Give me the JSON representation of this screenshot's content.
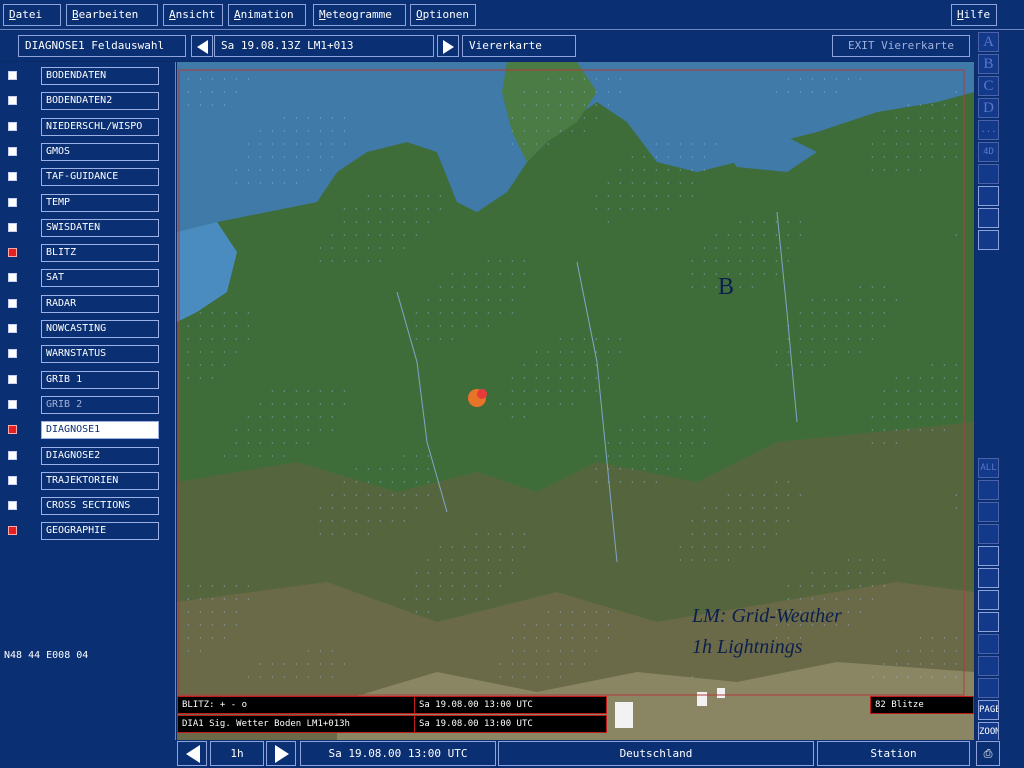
{
  "menu": {
    "items": [
      {
        "acc": "D",
        "rest": "atei"
      },
      {
        "acc": "B",
        "rest": "earbeiten"
      },
      {
        "acc": "A",
        "rest": "nsicht"
      },
      {
        "acc": "A",
        "rest": "nimation"
      },
      {
        "acc": "M",
        "rest": "eteogramme"
      },
      {
        "acc": "O",
        "rest": "ptionen"
      },
      {
        "acc": "H",
        "rest": "ilfe"
      }
    ]
  },
  "toolbar": {
    "selection_label": "DIAGNOSE1 Feldauswahl",
    "time_label": "Sa 19.08.13Z LM1+013",
    "view_label": "Viererkarte",
    "exit_label": "EXIT Viererkarte"
  },
  "layers": [
    {
      "label": "BODENDATEN",
      "checked": false,
      "state": "normal"
    },
    {
      "label": "BODENDATEN2",
      "checked": false,
      "state": "normal"
    },
    {
      "label": "NIEDERSCHL/WISPO",
      "checked": false,
      "state": "normal"
    },
    {
      "label": "GMOS",
      "checked": false,
      "state": "normal"
    },
    {
      "label": "TAF-GUIDANCE",
      "checked": false,
      "state": "normal"
    },
    {
      "label": "TEMP",
      "checked": false,
      "state": "normal"
    },
    {
      "label": "SWISDATEN",
      "checked": false,
      "state": "normal"
    },
    {
      "label": "BLITZ",
      "checked": true,
      "state": "normal"
    },
    {
      "label": "SAT",
      "checked": false,
      "state": "normal"
    },
    {
      "label": "RADAR",
      "checked": false,
      "state": "normal"
    },
    {
      "label": "NOWCASTING",
      "checked": false,
      "state": "normal"
    },
    {
      "label": "WARNSTATUS",
      "checked": false,
      "state": "normal"
    },
    {
      "label": "GRIB 1",
      "checked": false,
      "state": "normal"
    },
    {
      "label": "GRIB 2",
      "checked": false,
      "state": "disabled"
    },
    {
      "label": "DIAGNOSE1",
      "checked": true,
      "state": "active"
    },
    {
      "label": "DIAGNOSE2",
      "checked": false,
      "state": "normal"
    },
    {
      "label": "TRAJEKTORIEN",
      "checked": false,
      "state": "normal"
    },
    {
      "label": "CROSS SECTIONS",
      "checked": false,
      "state": "normal"
    },
    {
      "label": "GEOGRAPHIE",
      "checked": true,
      "state": "normal"
    }
  ],
  "coordinates": "N48 44 E008 04",
  "map": {
    "pressure_label": "B",
    "overlay_line1": "LM: Grid-Weather",
    "overlay_line2": "1h Lightnings",
    "info": {
      "blitz_legend": "BLITZ: + - o",
      "blitz_time": "Sa 19.08.00 13:00 UTC",
      "diag_legend": "DIA1 Sig. Wetter Boden LM1+013h",
      "diag_time": "Sa 19.08.00 13:00 UTC",
      "blitz_count": "82 Blitze"
    },
    "colors": {
      "sea": "#3f7aa8",
      "lowland": "#3f6d3a",
      "upland": "#6b6a48",
      "snow": "#f2f2f2",
      "rain_symbol": "#9fc4f0"
    }
  },
  "right_tools": {
    "letters": [
      "A",
      "B",
      "C",
      "D"
    ],
    "labels": [
      "...",
      "4D",
      "",
      "",
      "",
      "",
      "ALL",
      "",
      "",
      "",
      "",
      "",
      "",
      "",
      "",
      "",
      "",
      "PAGE",
      "ZOOM"
    ]
  },
  "bottom": {
    "step_label": "1h",
    "datetime": "Sa 19.08.00 13:00 UTC",
    "region": "Deutschland",
    "station": "Station"
  }
}
